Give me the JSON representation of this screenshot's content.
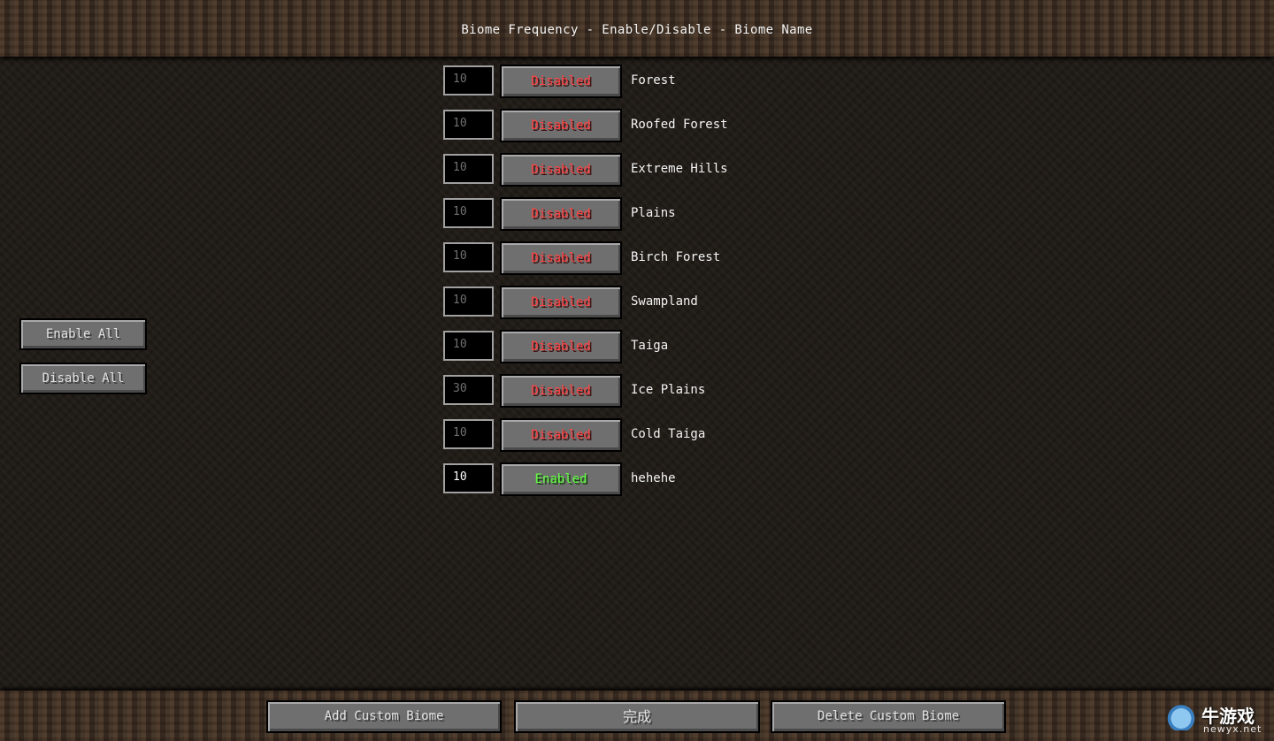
{
  "header": {
    "title": "Biome Frequency - Enable/Disable - Biome Name"
  },
  "side": {
    "enable_all": "Enable All",
    "disable_all": "Disable All"
  },
  "biomes": [
    {
      "frequency": "10",
      "state": "Disabled",
      "name": "Forest"
    },
    {
      "frequency": "10",
      "state": "Disabled",
      "name": "Roofed Forest"
    },
    {
      "frequency": "10",
      "state": "Disabled",
      "name": "Extreme Hills"
    },
    {
      "frequency": "10",
      "state": "Disabled",
      "name": "Plains"
    },
    {
      "frequency": "10",
      "state": "Disabled",
      "name": "Birch Forest"
    },
    {
      "frequency": "10",
      "state": "Disabled",
      "name": "Swampland"
    },
    {
      "frequency": "10",
      "state": "Disabled",
      "name": "Taiga"
    },
    {
      "frequency": "30",
      "state": "Disabled",
      "name": "Ice Plains"
    },
    {
      "frequency": "10",
      "state": "Disabled",
      "name": "Cold Taiga"
    },
    {
      "frequency": "10",
      "state": "Enabled",
      "name": "hehehe"
    }
  ],
  "footer": {
    "add_custom": "Add Custom Biome",
    "done": "完成",
    "delete_custom": "Delete Custom Biome"
  },
  "watermark": {
    "text": "牛游戏",
    "url": "newyx.net"
  },
  "colors": {
    "disabled": "#ff4040",
    "enabled": "#60ff40",
    "button": "#6f6f6f"
  }
}
